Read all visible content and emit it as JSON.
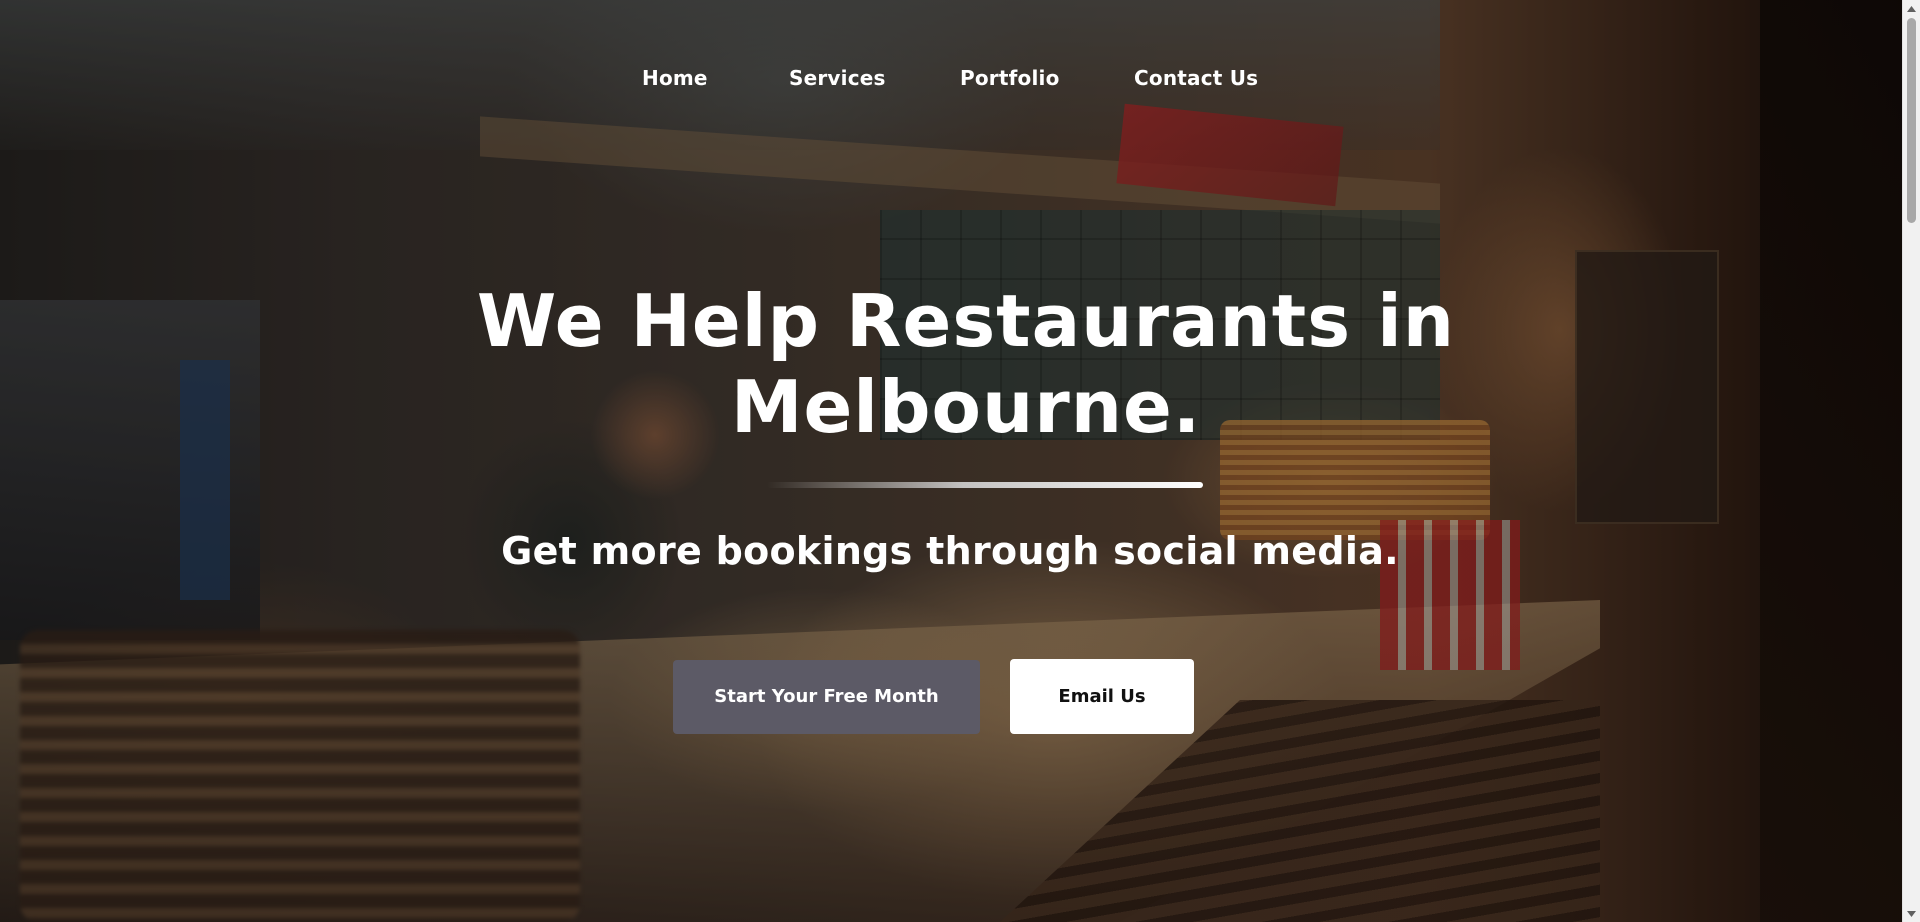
{
  "nav": {
    "items": [
      {
        "label": "Home"
      },
      {
        "label": "Services"
      },
      {
        "label": "Portfolio"
      },
      {
        "label": "Contact Us"
      }
    ]
  },
  "hero": {
    "title_line1": "We Help Restaurants in",
    "title_line2": "Melbourne.",
    "subtitle": "Get more bookings through social media.",
    "background_image": "restaurant-kitchen-photo",
    "primary_button": {
      "label": "Start Your Free Month",
      "color": "#5c5a66"
    },
    "secondary_button": {
      "label": "Email Us",
      "color": "#ffffff"
    }
  },
  "scrollbar": {
    "up_icon": "chevron-up-icon",
    "down_icon": "chevron-down-icon"
  }
}
